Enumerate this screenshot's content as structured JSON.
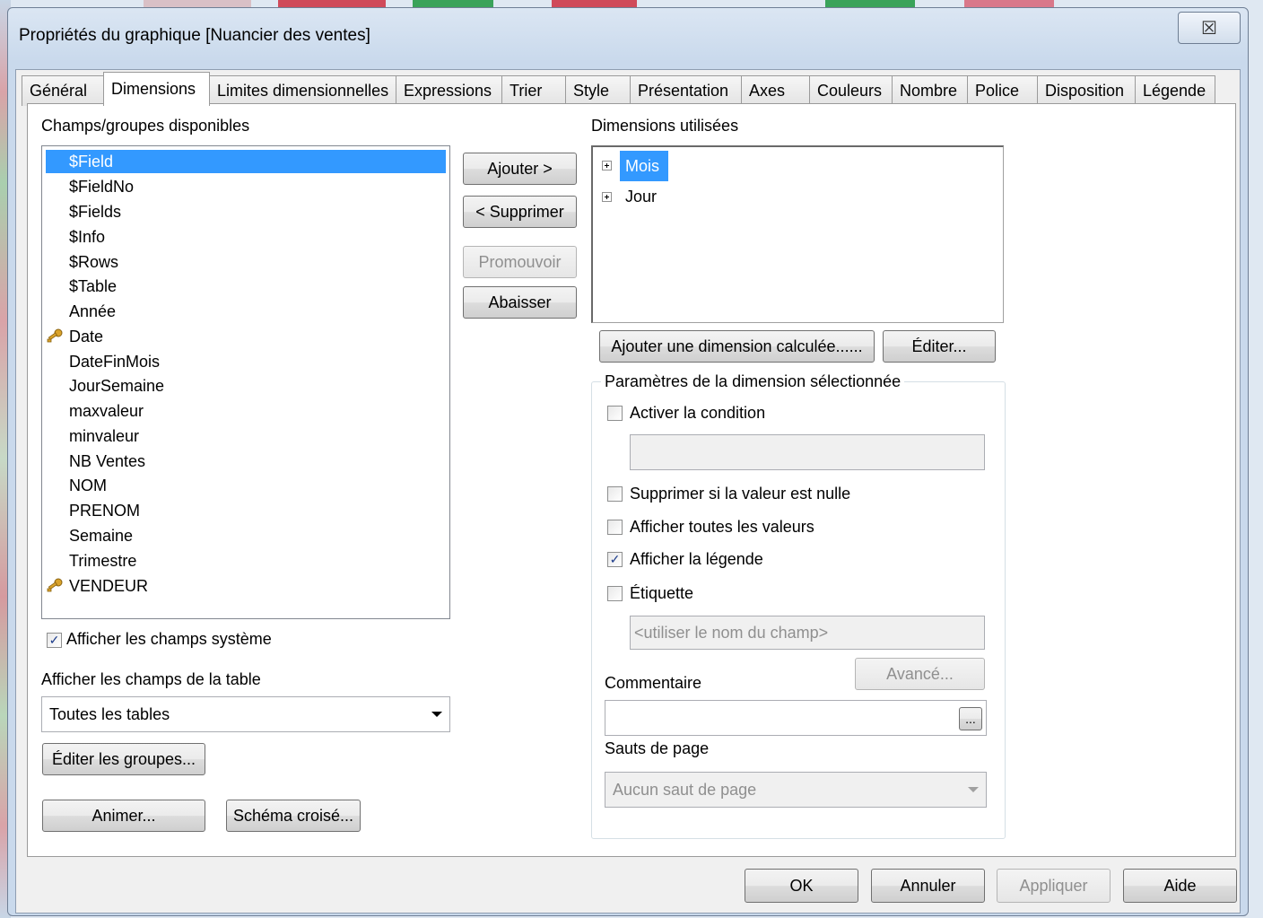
{
  "window": {
    "title": "Propriétés du graphique [Nuancier des ventes]",
    "close_glyph": "☒"
  },
  "tabs": [
    {
      "label": "Général"
    },
    {
      "label": "Dimensions",
      "active": true
    },
    {
      "label": "Limites dimensionnelles"
    },
    {
      "label": "Expressions"
    },
    {
      "label": "Trier"
    },
    {
      "label": "Style"
    },
    {
      "label": "Présentation"
    },
    {
      "label": "Axes"
    },
    {
      "label": "Couleurs"
    },
    {
      "label": "Nombre"
    },
    {
      "label": "Police"
    },
    {
      "label": "Disposition"
    },
    {
      "label": "Légende"
    }
  ],
  "available": {
    "label": "Champs/groupes disponibles",
    "fields": [
      {
        "name": "$Field",
        "selected": true
      },
      {
        "name": "$FieldNo"
      },
      {
        "name": "$Fields"
      },
      {
        "name": "$Info"
      },
      {
        "name": "$Rows"
      },
      {
        "name": "$Table"
      },
      {
        "name": "Année"
      },
      {
        "name": "Date",
        "key": true
      },
      {
        "name": "DateFinMois"
      },
      {
        "name": "JourSemaine"
      },
      {
        "name": "maxvaleur"
      },
      {
        "name": "minvaleur"
      },
      {
        "name": "NB Ventes"
      },
      {
        "name": "NOM"
      },
      {
        "name": "PRENOM"
      },
      {
        "name": "Semaine"
      },
      {
        "name": "Trimestre"
      },
      {
        "name": "VENDEUR",
        "key": true
      }
    ],
    "show_system_label": "Afficher les champs système",
    "show_system_checked": true,
    "table_label": "Afficher les champs de la table",
    "table_value": "Toutes les tables",
    "edit_groups_label": "Éditer les groupes...",
    "animate_label": "Animer...",
    "cross_label": "Schéma croisé..."
  },
  "buttons": {
    "add": "Ajouter >",
    "remove": "< Supprimer",
    "promote": "Promouvoir",
    "demote": "Abaisser"
  },
  "used": {
    "label": "Dimensions utilisées",
    "items": [
      {
        "name": "Mois",
        "selected": true
      },
      {
        "name": "Jour"
      }
    ],
    "add_calc_label": "Ajouter une dimension calculée......",
    "edit_label": "Éditer..."
  },
  "params": {
    "title": "Paramètres de la dimension sélectionnée",
    "enable_condition": "Activer la condition",
    "suppress_null": "Supprimer si la valeur est nulle",
    "show_all": "Afficher toutes les valeurs",
    "show_legend": "Afficher la légende",
    "label": "Étiquette",
    "label_placeholder": "<utiliser le nom du champ>",
    "advanced": "Avancé...",
    "comment": "Commentaire",
    "comment_btn": "...",
    "page_breaks": "Sauts de page",
    "page_breaks_value": "Aucun saut de page"
  },
  "footer": {
    "ok": "OK",
    "cancel": "Annuler",
    "apply": "Appliquer",
    "help": "Aide"
  },
  "colors": {
    "selection": "#3399ff",
    "chrome": "#c9d9ec"
  }
}
